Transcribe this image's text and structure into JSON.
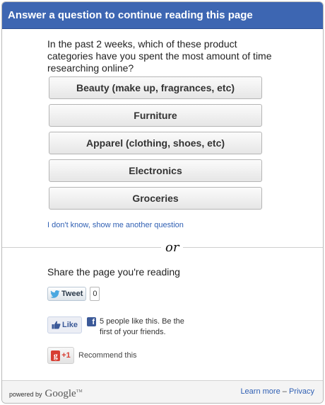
{
  "header": {
    "title": "Answer a question to continue reading this page"
  },
  "survey": {
    "question": "In the past 2 weeks, which of these product categories have you spent the most amount of time researching online?",
    "answers": [
      "Beauty (make up, fragrances, etc)",
      "Furniture",
      "Apparel (clothing, shoes, etc)",
      "Electronics",
      "Groceries"
    ],
    "skip_link": "I don't know, show me another question"
  },
  "separator": {
    "or_label": "or"
  },
  "share": {
    "title": "Share the page you're reading",
    "tweet": {
      "label": "Tweet",
      "count": "0"
    },
    "facebook": {
      "like_label": "Like",
      "text": "5 people like this. Be the first of your friends."
    },
    "gplus": {
      "label": "+1",
      "recommend": "Recommend this"
    }
  },
  "footer": {
    "powered_by": "powered by",
    "brand": "Google",
    "tm": "TM",
    "learn_more": "Learn more",
    "dash": " – ",
    "privacy": "Privacy"
  },
  "colors": {
    "header_bg": "#3d66b2",
    "link": "#2f5fb3",
    "facebook": "#3b5998",
    "gplus": "#d73d32"
  }
}
